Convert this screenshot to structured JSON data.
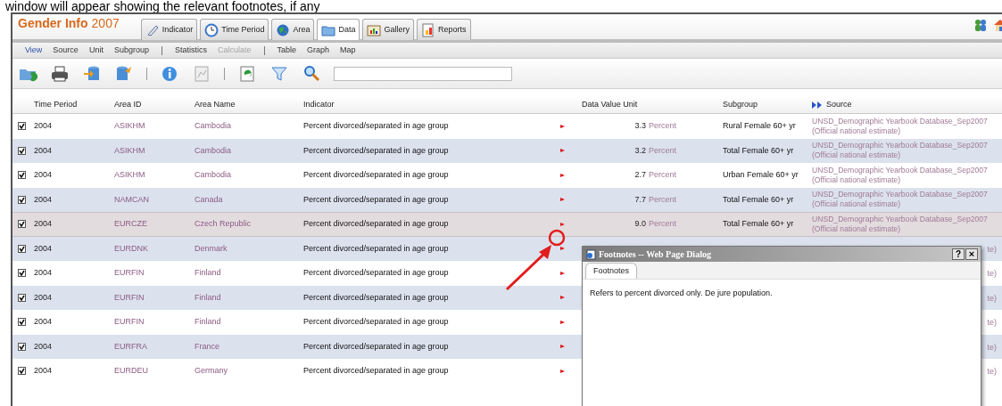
{
  "caption": "window will appear showing the relevant footnotes, if any",
  "app": {
    "title": "Gender Info",
    "year": "2007"
  },
  "tabs": [
    {
      "label": "Indicator",
      "selected": false
    },
    {
      "label": "Time Period",
      "selected": false
    },
    {
      "label": "Area",
      "selected": false
    },
    {
      "label": "Data",
      "selected": true
    },
    {
      "label": "Gallery",
      "selected": false
    },
    {
      "label": "Reports",
      "selected": false
    }
  ],
  "menu_groups": [
    [
      {
        "label": "View",
        "selected": true,
        "disabled": false
      },
      {
        "label": "Source",
        "selected": false,
        "disabled": false
      },
      {
        "label": "Unit",
        "selected": false,
        "disabled": false
      },
      {
        "label": "Subgroup",
        "selected": false,
        "disabled": false
      }
    ],
    [
      {
        "label": "Statistics",
        "selected": false,
        "disabled": false
      },
      {
        "label": "Calculate",
        "selected": false,
        "disabled": true
      }
    ],
    [
      {
        "label": "Table",
        "selected": false,
        "disabled": false
      },
      {
        "label": "Graph",
        "selected": false,
        "disabled": false
      },
      {
        "label": "Map",
        "selected": false,
        "disabled": false
      }
    ]
  ],
  "table": {
    "columns": [
      "Time Period",
      "Area ID",
      "Area Name",
      "Indicator",
      "Data Value Unit",
      "Subgroup",
      "Source"
    ],
    "rows": [
      {
        "checked": true,
        "selected": false,
        "time_period": "2004",
        "area_id": "ASIKHM",
        "area_name": "Cambodia",
        "indicator": "Percent divorced/separated in age group",
        "value": "3.3",
        "unit": "Percent",
        "subgroup": "Rural Female 60+ yr",
        "source": "UNSD_Demographic Yearbook Database_Sep2007 (Official national estimate)"
      },
      {
        "checked": true,
        "selected": false,
        "time_period": "2004",
        "area_id": "ASIKHM",
        "area_name": "Cambodia",
        "indicator": "Percent divorced/separated in age group",
        "value": "3.2",
        "unit": "Percent",
        "subgroup": "Total Female 60+ yr",
        "source": "UNSD_Demographic Yearbook Database_Sep2007 (Official national estimate)"
      },
      {
        "checked": true,
        "selected": false,
        "time_period": "2004",
        "area_id": "ASIKHM",
        "area_name": "Cambodia",
        "indicator": "Percent divorced/separated in age group",
        "value": "2.7",
        "unit": "Percent",
        "subgroup": "Urban Female 60+ yr",
        "source": "UNSD_Demographic Yearbook Database_Sep2007 (Official national estimate)"
      },
      {
        "checked": true,
        "selected": false,
        "time_period": "2004",
        "area_id": "NAMCAN",
        "area_name": "Canada",
        "indicator": "Percent divorced/separated in age group",
        "value": "7.7",
        "unit": "Percent",
        "subgroup": "Total Female 60+ yr",
        "source": "UNSD_Demographic Yearbook Database_Sep2007 (Official national estimate)"
      },
      {
        "checked": true,
        "selected": true,
        "time_period": "2004",
        "area_id": "EURCZE",
        "area_name": "Czech Republic",
        "indicator": "Percent divorced/separated in age group",
        "value": "9.0",
        "unit": "Percent",
        "subgroup": "Total Female 60+ yr",
        "source": "UNSD_Demographic Yearbook Database_Sep2007 (Official national estimate)"
      },
      {
        "checked": true,
        "selected": false,
        "time_period": "2004",
        "area_id": "EURDNK",
        "area_name": "Denmark",
        "indicator": "Percent divorced/separated in age group",
        "source": "te)"
      },
      {
        "checked": true,
        "selected": false,
        "time_period": "2004",
        "area_id": "EURFIN",
        "area_name": "Finland",
        "indicator": "Percent divorced/separated in age group",
        "source": "te)"
      },
      {
        "checked": true,
        "selected": false,
        "time_period": "2004",
        "area_id": "EURFIN",
        "area_name": "Finland",
        "indicator": "Percent divorced/separated in age group",
        "source": "te)"
      },
      {
        "checked": true,
        "selected": false,
        "time_period": "2004",
        "area_id": "EURFIN",
        "area_name": "Finland",
        "indicator": "Percent divorced/separated in age group",
        "source": "te)"
      },
      {
        "checked": true,
        "selected": false,
        "time_period": "2004",
        "area_id": "EURFRA",
        "area_name": "France",
        "indicator": "Percent divorced/separated in age group",
        "source": "te)"
      },
      {
        "checked": true,
        "selected": false,
        "time_period": "2004",
        "area_id": "EURDEU",
        "area_name": "Germany",
        "indicator": "Percent divorced/separated in age group",
        "source": "te)"
      }
    ]
  },
  "dialog": {
    "title": "Footnotes -- Web Page Dialog",
    "help": "?",
    "close": "×",
    "tab": "Footnotes",
    "text": "Refers to percent divorced only. De jure population."
  }
}
